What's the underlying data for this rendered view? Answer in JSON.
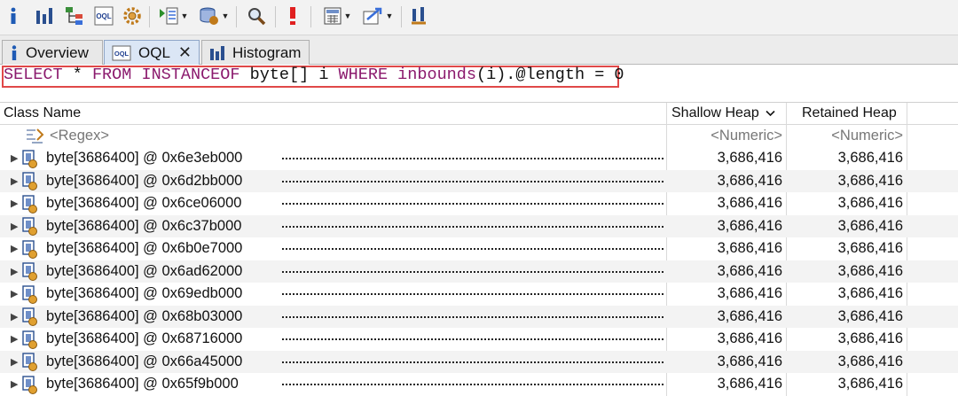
{
  "toolbar": {
    "buttons": [
      {
        "name": "info-icon"
      },
      {
        "name": "histogram-icon"
      },
      {
        "name": "dominator-tree-icon"
      },
      {
        "name": "oql-icon",
        "text": "OQL"
      },
      {
        "name": "settings-icon"
      },
      {
        "name": "group-by-icon"
      },
      {
        "name": "heap-dump-icon"
      },
      {
        "name": "search-icon"
      },
      {
        "name": "leak-suspects-icon"
      },
      {
        "name": "calculator-icon"
      },
      {
        "name": "export-icon"
      },
      {
        "name": "pin-icon"
      }
    ]
  },
  "tabs": [
    {
      "label": "Overview",
      "icon": "info-icon",
      "active": false
    },
    {
      "label": "OQL",
      "icon": "oql-icon",
      "active": true,
      "closable": true
    },
    {
      "label": "Histogram",
      "icon": "histogram-icon",
      "active": false
    }
  ],
  "query": {
    "tokens": [
      {
        "t": "SELECT",
        "k": "kw"
      },
      {
        "t": " * ",
        "k": "ip"
      },
      {
        "t": "FROM",
        "k": "kw"
      },
      {
        "t": " ",
        "k": "ip"
      },
      {
        "t": "INSTANCEOF",
        "k": "kw"
      },
      {
        "t": " byte[] i ",
        "k": "ip"
      },
      {
        "t": "WHERE",
        "k": "kw"
      },
      {
        "t": " ",
        "k": "ip"
      },
      {
        "t": "inbounds",
        "k": "kw"
      },
      {
        "t": "(i).@length = 0",
        "k": "ip"
      }
    ]
  },
  "table": {
    "columns": {
      "class_name": "Class Name",
      "shallow_heap": "Shallow Heap",
      "retained_heap": "Retained Heap"
    },
    "filter_row": {
      "class_name": "<Regex>",
      "shallow_heap": "<Numeric>",
      "retained_heap": "<Numeric>"
    },
    "rows": [
      {
        "name": "byte[3686400] @ 0x6e3eb000",
        "shallow": "3,686,416",
        "retained": "3,686,416"
      },
      {
        "name": "byte[3686400] @ 0x6d2bb000",
        "shallow": "3,686,416",
        "retained": "3,686,416"
      },
      {
        "name": "byte[3686400] @ 0x6ce06000",
        "shallow": "3,686,416",
        "retained": "3,686,416"
      },
      {
        "name": "byte[3686400] @ 0x6c37b000",
        "shallow": "3,686,416",
        "retained": "3,686,416"
      },
      {
        "name": "byte[3686400] @ 0x6b0e7000",
        "shallow": "3,686,416",
        "retained": "3,686,416"
      },
      {
        "name": "byte[3686400] @ 0x6ad62000",
        "shallow": "3,686,416",
        "retained": "3,686,416"
      },
      {
        "name": "byte[3686400] @ 0x69edb000",
        "shallow": "3,686,416",
        "retained": "3,686,416"
      },
      {
        "name": "byte[3686400] @ 0x68b03000",
        "shallow": "3,686,416",
        "retained": "3,686,416"
      },
      {
        "name": "byte[3686400] @ 0x68716000",
        "shallow": "3,686,416",
        "retained": "3,686,416"
      },
      {
        "name": "byte[3686400] @ 0x66a45000",
        "shallow": "3,686,416",
        "retained": "3,686,416"
      },
      {
        "name": "byte[3686400] @ 0x65f9b000",
        "shallow": "3,686,416",
        "retained": "3,686,416"
      }
    ]
  },
  "colors": {
    "keyword": "#8b1a6d",
    "query_highlight_border": "#e04848",
    "active_tab": "#dbe6f5"
  }
}
